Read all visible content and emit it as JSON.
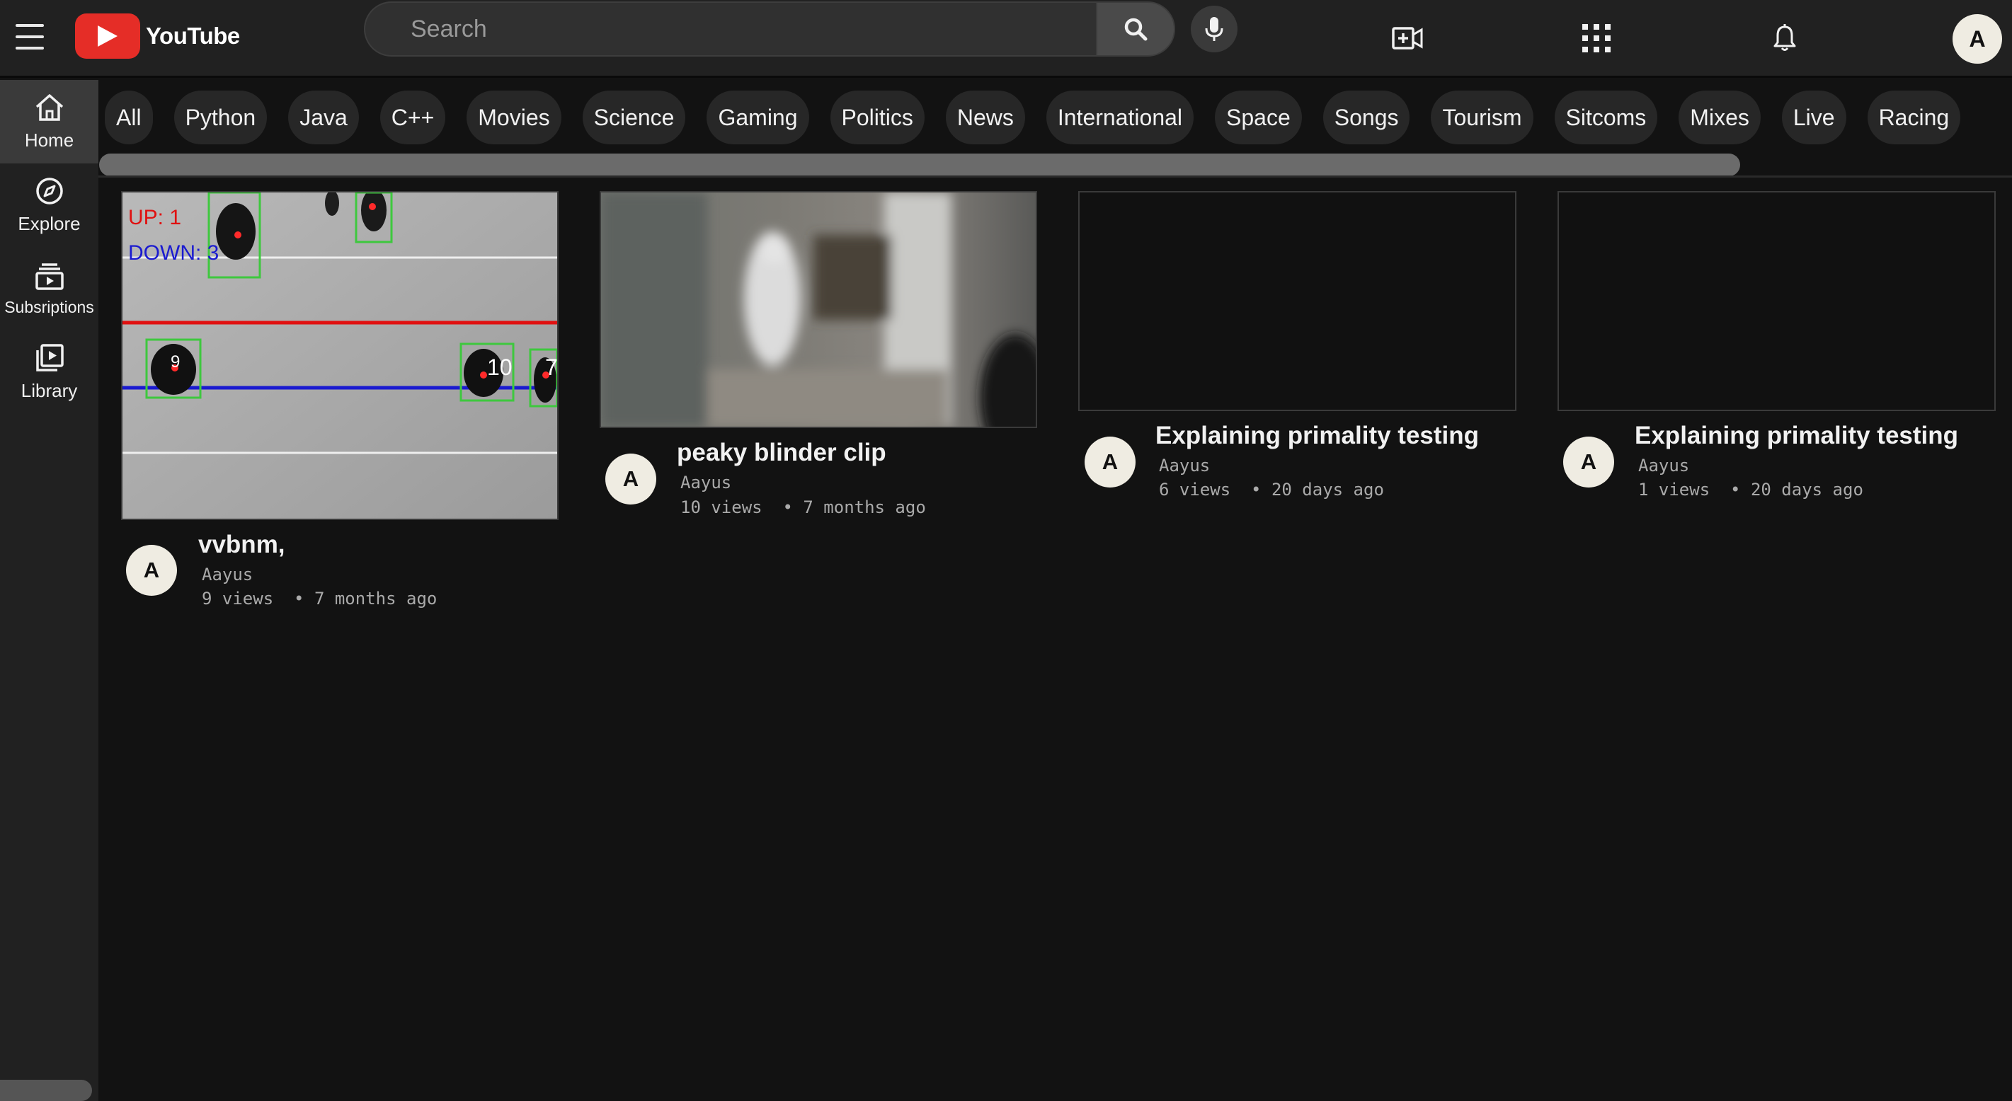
{
  "header": {
    "logo_text": "YouTube",
    "search_placeholder": "Search",
    "avatar_letter": "A"
  },
  "sidebar": {
    "items": [
      {
        "label": "Home",
        "icon": "home-icon",
        "active": true
      },
      {
        "label": "Explore",
        "icon": "compass-icon",
        "active": false
      },
      {
        "label": "Subsriptions",
        "icon": "subscriptions-icon",
        "active": false
      },
      {
        "label": "Library",
        "icon": "library-icon",
        "active": false
      }
    ]
  },
  "chips": [
    "All",
    "Python",
    "Java",
    "C++",
    "Movies",
    "Science",
    "Gaming",
    "Politics",
    "News",
    "International",
    "Space",
    "Songs",
    "Tourism",
    "Sitcoms",
    "Mixes",
    "Live",
    "Racing"
  ],
  "videos": [
    {
      "title": "vvbnm,",
      "channel": "Aayus",
      "views": "9 views",
      "age": "7 months ago",
      "avatar_letter": "A",
      "overlay": {
        "up_label": "UP: 1",
        "down_label": "DOWN: 3",
        "ids": [
          "9",
          "10",
          "7"
        ]
      }
    },
    {
      "title": "peaky blinder clip",
      "channel": "Aayus",
      "views": "10 views",
      "age": "7 months ago",
      "avatar_letter": "A"
    },
    {
      "title": "Explaining primality testing",
      "channel": "Aayus",
      "views": "6 views",
      "age": "20 days ago",
      "avatar_letter": "A"
    },
    {
      "title": "Explaining primality testing",
      "channel": "Aayus",
      "views": "1 views",
      "age": "20 days ago",
      "avatar_letter": "A"
    }
  ],
  "colors": {
    "background": "#121212",
    "header": "#212121",
    "accent": "#e52d27",
    "chip": "#272727"
  }
}
